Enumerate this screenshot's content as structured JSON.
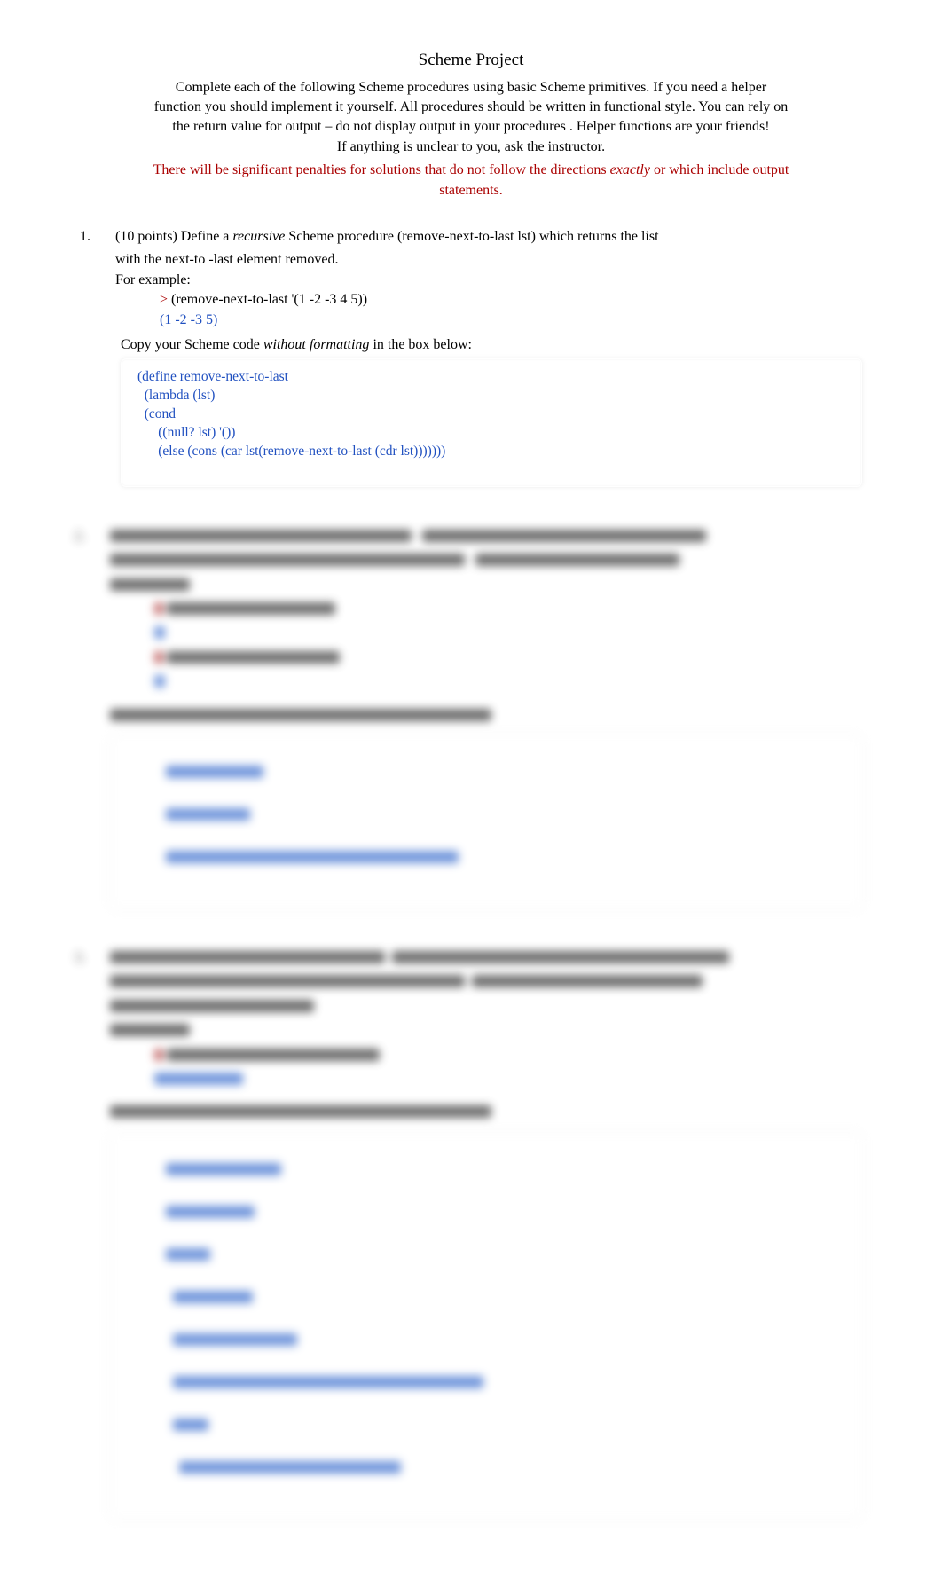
{
  "title": "Scheme Project",
  "intro": {
    "line1a": "Complete each of the following Scheme procedures using ",
    "line1b": "basic Scheme primitives",
    "line1c": ".  If you need a helper",
    "line2": "function you should implement it yourself.    All procedures should be written in functional style.     You can rely on",
    "line3": "the return value for output –    do not display output in your procedures   .   Helper functions are your friends!",
    "line4": "If anything is unclear to you, ask the instructor."
  },
  "warning": {
    "pre": "There will be significant penalties for solutions that do not follow the directions ",
    "em": "exactly",
    "post": " or which include output",
    "line2": "statements."
  },
  "q1": {
    "num": "1.",
    "points": "(10 points) Define a ",
    "recursive": "recursive",
    "mid": " Scheme procedure   ",
    "proc": "(remove-next-to-last lst)",
    "tail": "                    which returns the list",
    "line2": "with the next-to -last element removed.",
    "forexample": "For example:",
    "prompt": ">",
    "call": "   (remove-next-to-last '(1 -2 -3 4 5))",
    "output": "(1 -2 -3 5)",
    "copy_pre": "Copy your Scheme code  ",
    "copy_em": "without formatting",
    "copy_post": "   in the box below:",
    "answer": "(define remove-next-to-last\n  (lambda (lst)\n  (cond\n      ((null? lst) '())\n      (else (cons (car lst(remove-next-to-last (cdr lst)))))))"
  },
  "blurred_placeholder": {
    "block2_text": "█████████████████████████████████████████████████████████",
    "block3_text": "█████████████████████████████████████████████████████████"
  }
}
